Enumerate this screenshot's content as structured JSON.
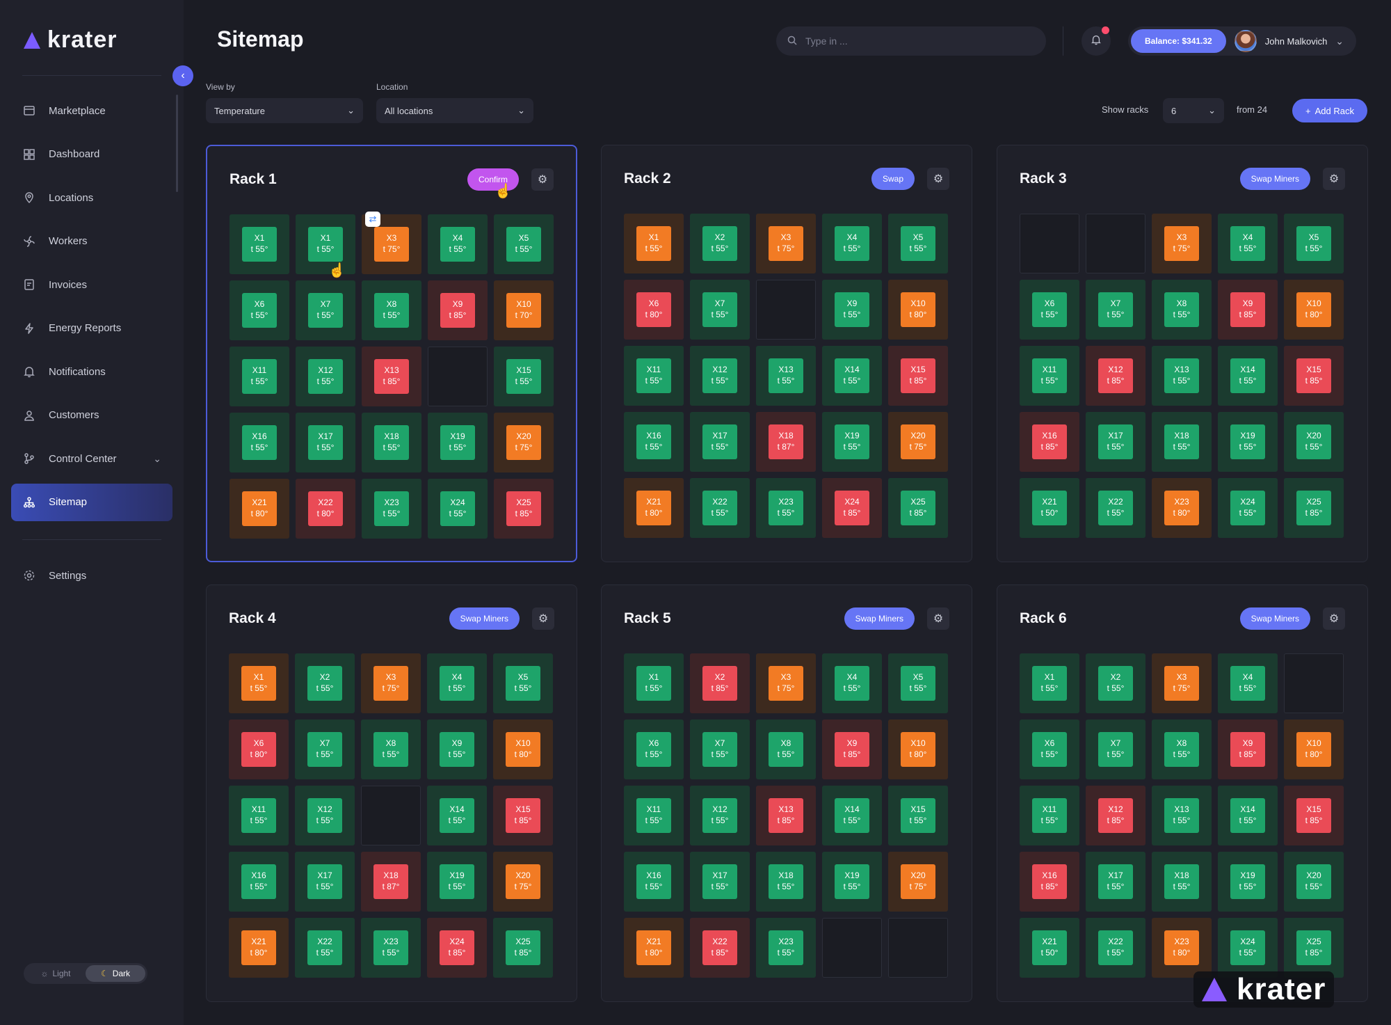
{
  "app": {
    "logo_text": "krater",
    "brand_color": "#7b5cff"
  },
  "sidebar": {
    "items": [
      {
        "label": "Marketplace",
        "icon": "store-icon"
      },
      {
        "label": "Dashboard",
        "icon": "dashboard-icon"
      },
      {
        "label": "Locations",
        "icon": "location-pin-icon"
      },
      {
        "label": "Workers",
        "icon": "fan-icon"
      },
      {
        "label": "Invoices",
        "icon": "invoice-icon"
      },
      {
        "label": "Energy Reports",
        "icon": "energy-icon"
      },
      {
        "label": "Notifications",
        "icon": "bell-icon"
      },
      {
        "label": "Customers",
        "icon": "user-icon"
      },
      {
        "label": "Control Center",
        "icon": "branch-icon"
      },
      {
        "label": "Sitemap",
        "icon": "sitemap-icon"
      }
    ],
    "active": "Sitemap",
    "settings_label": "Settings",
    "theme": {
      "light": "Light",
      "dark": "Dark",
      "selected": "Dark"
    }
  },
  "header": {
    "title": "Sitemap",
    "search_placeholder": "Type in ...",
    "balance": "Balance: $341.32",
    "user_name": "John Malkovich"
  },
  "filters": {
    "view_by_label": "View by",
    "view_by_value": "Temperature",
    "location_label": "Location",
    "location_value": "All locations",
    "show_racks_label": "Show racks",
    "show_racks_value": "6",
    "from_label": "from 24",
    "add_rack_label": "Add Rack"
  },
  "status_colors": {
    "ok": "#1ea46a",
    "warm": "#f27b24",
    "hot": "#ea4b56"
  },
  "racks": [
    {
      "title": "Rack 1",
      "button": "Confirm",
      "cells": [
        [
          "g",
          "X1",
          "t 55°"
        ],
        [
          "g",
          "X1",
          "t 55°"
        ],
        [
          "o",
          "X3",
          "t 75°"
        ],
        [
          "g",
          "X4",
          "t 55°"
        ],
        [
          "g",
          "X5",
          "t 55°"
        ],
        [
          "g",
          "X6",
          "t 55°"
        ],
        [
          "g",
          "X7",
          "t 55°"
        ],
        [
          "g",
          "X8",
          "t 55°"
        ],
        [
          "r",
          "X9",
          "t 85°"
        ],
        [
          "o",
          "X10",
          "t 70°"
        ],
        [
          "g",
          "X11",
          "t 55°"
        ],
        [
          "g",
          "X12",
          "t 55°"
        ],
        [
          "r",
          "X13",
          "t 85°"
        ],
        [
          "e",
          "",
          ""
        ],
        [
          "g",
          "X15",
          "t 55°"
        ],
        [
          "g",
          "X16",
          "t 55°"
        ],
        [
          "g",
          "X17",
          "t 55°"
        ],
        [
          "g",
          "X18",
          "t 55°"
        ],
        [
          "g",
          "X19",
          "t 55°"
        ],
        [
          "o",
          "X20",
          "t 75°"
        ],
        [
          "o",
          "X21",
          "t 80°"
        ],
        [
          "r",
          "X22",
          "t 80°"
        ],
        [
          "g",
          "X23",
          "t 55°"
        ],
        [
          "g",
          "X24",
          "t 55°"
        ],
        [
          "r",
          "X25",
          "t 85°"
        ]
      ]
    },
    {
      "title": "Rack 2",
      "button": "Swap",
      "cells": [
        [
          "o",
          "X1",
          "t 55°"
        ],
        [
          "g",
          "X2",
          "t 55°"
        ],
        [
          "o",
          "X3",
          "t 75°"
        ],
        [
          "g",
          "X4",
          "t 55°"
        ],
        [
          "g",
          "X5",
          "t 55°"
        ],
        [
          "r",
          "X6",
          "t 80°"
        ],
        [
          "g",
          "X7",
          "t 55°"
        ],
        [
          "e",
          "",
          ""
        ],
        [
          "g",
          "X9",
          "t 55°"
        ],
        [
          "o",
          "X10",
          "t 80°"
        ],
        [
          "g",
          "X11",
          "t 55°"
        ],
        [
          "g",
          "X12",
          "t 55°"
        ],
        [
          "g",
          "X13",
          "t 55°"
        ],
        [
          "g",
          "X14",
          "t 55°"
        ],
        [
          "r",
          "X15",
          "t 85°"
        ],
        [
          "g",
          "X16",
          "t 55°"
        ],
        [
          "g",
          "X17",
          "t 55°"
        ],
        [
          "r",
          "X18",
          "t 87°"
        ],
        [
          "g",
          "X19",
          "t 55°"
        ],
        [
          "o",
          "X20",
          "t 75°"
        ],
        [
          "o",
          "X21",
          "t 80°"
        ],
        [
          "g",
          "X22",
          "t 55°"
        ],
        [
          "g",
          "X23",
          "t 55°"
        ],
        [
          "r",
          "X24",
          "t 85°"
        ],
        [
          "g",
          "X25",
          "t 85°"
        ]
      ]
    },
    {
      "title": "Rack 3",
      "button": "Swap Miners",
      "cells": [
        [
          "e",
          "",
          ""
        ],
        [
          "e",
          "",
          ""
        ],
        [
          "o",
          "X3",
          "t 75°"
        ],
        [
          "g",
          "X4",
          "t 55°"
        ],
        [
          "g",
          "X5",
          "t 55°"
        ],
        [
          "g",
          "X6",
          "t 55°"
        ],
        [
          "g",
          "X7",
          "t 55°"
        ],
        [
          "g",
          "X8",
          "t 55°"
        ],
        [
          "r",
          "X9",
          "t 85°"
        ],
        [
          "o",
          "X10",
          "t 80°"
        ],
        [
          "g",
          "X11",
          "t 55°"
        ],
        [
          "r",
          "X12",
          "t 85°"
        ],
        [
          "g",
          "X13",
          "t 55°"
        ],
        [
          "g",
          "X14",
          "t 55°"
        ],
        [
          "r",
          "X15",
          "t 85°"
        ],
        [
          "r",
          "X16",
          "t 85°"
        ],
        [
          "g",
          "X17",
          "t 55°"
        ],
        [
          "g",
          "X18",
          "t 55°"
        ],
        [
          "g",
          "X19",
          "t 55°"
        ],
        [
          "g",
          "X20",
          "t 55°"
        ],
        [
          "g",
          "X21",
          "t 50°"
        ],
        [
          "g",
          "X22",
          "t 55°"
        ],
        [
          "o",
          "X23",
          "t 80°"
        ],
        [
          "g",
          "X24",
          "t 55°"
        ],
        [
          "g",
          "X25",
          "t 85°"
        ]
      ]
    },
    {
      "title": "Rack 4",
      "button": "Swap Miners",
      "cells": [
        [
          "o",
          "X1",
          "t 55°"
        ],
        [
          "g",
          "X2",
          "t 55°"
        ],
        [
          "o",
          "X3",
          "t 75°"
        ],
        [
          "g",
          "X4",
          "t 55°"
        ],
        [
          "g",
          "X5",
          "t 55°"
        ],
        [
          "r",
          "X6",
          "t 80°"
        ],
        [
          "g",
          "X7",
          "t 55°"
        ],
        [
          "g",
          "X8",
          "t 55°"
        ],
        [
          "g",
          "X9",
          "t 55°"
        ],
        [
          "o",
          "X10",
          "t 80°"
        ],
        [
          "g",
          "X11",
          "t 55°"
        ],
        [
          "g",
          "X12",
          "t 55°"
        ],
        [
          "e",
          "",
          ""
        ],
        [
          "g",
          "X14",
          "t 55°"
        ],
        [
          "r",
          "X15",
          "t 85°"
        ],
        [
          "g",
          "X16",
          "t 55°"
        ],
        [
          "g",
          "X17",
          "t 55°"
        ],
        [
          "r",
          "X18",
          "t 87°"
        ],
        [
          "g",
          "X19",
          "t 55°"
        ],
        [
          "o",
          "X20",
          "t 75°"
        ],
        [
          "o",
          "X21",
          "t 80°"
        ],
        [
          "g",
          "X22",
          "t 55°"
        ],
        [
          "g",
          "X23",
          "t 55°"
        ],
        [
          "r",
          "X24",
          "t 85°"
        ],
        [
          "g",
          "X25",
          "t 85°"
        ]
      ]
    },
    {
      "title": "Rack 5",
      "button": "Swap Miners",
      "cells": [
        [
          "g",
          "X1",
          "t 55°"
        ],
        [
          "r",
          "X2",
          "t 85°"
        ],
        [
          "o",
          "X3",
          "t 75°"
        ],
        [
          "g",
          "X4",
          "t 55°"
        ],
        [
          "g",
          "X5",
          "t 55°"
        ],
        [
          "g",
          "X6",
          "t 55°"
        ],
        [
          "g",
          "X7",
          "t 55°"
        ],
        [
          "g",
          "X8",
          "t 55°"
        ],
        [
          "r",
          "X9",
          "t 85°"
        ],
        [
          "o",
          "X10",
          "t 80°"
        ],
        [
          "g",
          "X11",
          "t 55°"
        ],
        [
          "g",
          "X12",
          "t 55°"
        ],
        [
          "r",
          "X13",
          "t 85°"
        ],
        [
          "g",
          "X14",
          "t 55°"
        ],
        [
          "g",
          "X15",
          "t 55°"
        ],
        [
          "g",
          "X16",
          "t 55°"
        ],
        [
          "g",
          "X17",
          "t 55°"
        ],
        [
          "g",
          "X18",
          "t 55°"
        ],
        [
          "g",
          "X19",
          "t 55°"
        ],
        [
          "o",
          "X20",
          "t 75°"
        ],
        [
          "o",
          "X21",
          "t 80°"
        ],
        [
          "r",
          "X22",
          "t 85°"
        ],
        [
          "g",
          "X23",
          "t 55°"
        ],
        [
          "e",
          "",
          ""
        ],
        [
          "e",
          "",
          ""
        ]
      ]
    },
    {
      "title": "Rack 6",
      "button": "Swap Miners",
      "cells": [
        [
          "g",
          "X1",
          "t 55°"
        ],
        [
          "g",
          "X2",
          "t 55°"
        ],
        [
          "o",
          "X3",
          "t 75°"
        ],
        [
          "g",
          "X4",
          "t 55°"
        ],
        [
          "e",
          "",
          ""
        ],
        [
          "g",
          "X6",
          "t 55°"
        ],
        [
          "g",
          "X7",
          "t 55°"
        ],
        [
          "g",
          "X8",
          "t 55°"
        ],
        [
          "r",
          "X9",
          "t 85°"
        ],
        [
          "o",
          "X10",
          "t 80°"
        ],
        [
          "g",
          "X11",
          "t 55°"
        ],
        [
          "r",
          "X12",
          "t 85°"
        ],
        [
          "g",
          "X13",
          "t 55°"
        ],
        [
          "g",
          "X14",
          "t 55°"
        ],
        [
          "r",
          "X15",
          "t 85°"
        ],
        [
          "r",
          "X16",
          "t 85°"
        ],
        [
          "g",
          "X17",
          "t 55°"
        ],
        [
          "g",
          "X18",
          "t 55°"
        ],
        [
          "g",
          "X19",
          "t 55°"
        ],
        [
          "g",
          "X20",
          "t 55°"
        ],
        [
          "g",
          "X21",
          "t 50°"
        ],
        [
          "g",
          "X22",
          "t 55°"
        ],
        [
          "o",
          "X23",
          "t 80°"
        ],
        [
          "g",
          "X24",
          "t 55°"
        ],
        [
          "g",
          "X25",
          "t 85°"
        ]
      ]
    }
  ],
  "watermark": "krater"
}
